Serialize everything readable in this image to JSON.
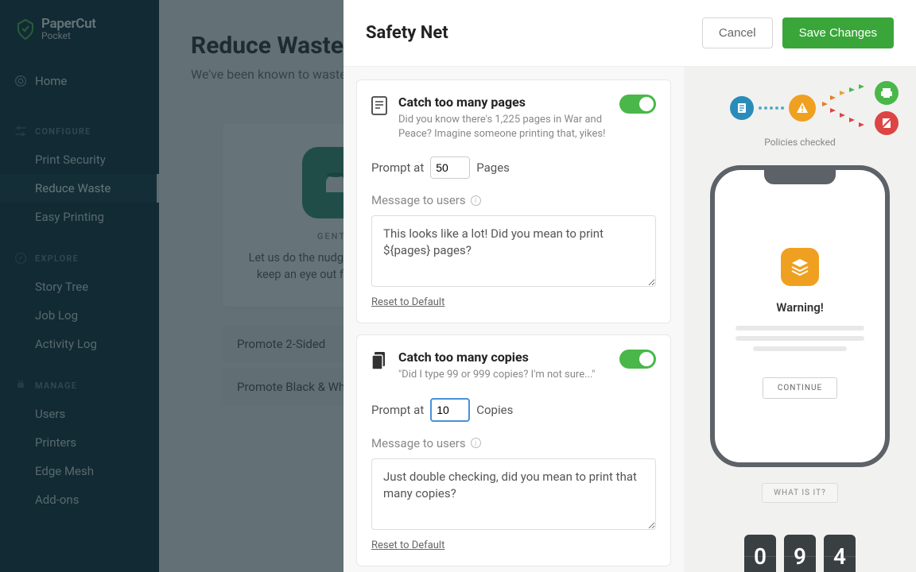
{
  "brand": {
    "title": "PaperCut",
    "subtitle": "Pocket"
  },
  "nav": {
    "home": "Home",
    "configure_header": "CONFIGURE",
    "configure": [
      "Print Security",
      "Reduce Waste",
      "Easy Printing"
    ],
    "explore_header": "EXPLORE",
    "explore": [
      "Story Tree",
      "Job Log",
      "Activity Log"
    ],
    "manage_header": "MANAGE",
    "manage": [
      "Users",
      "Printers",
      "Edge Mesh",
      "Add-ons"
    ]
  },
  "page": {
    "title": "Reduce Waste",
    "subtitle": "We've been known to waste a bit of paper in our time.",
    "card": {
      "badge": "GENTLE",
      "text": "Let us do the nudging for you. We'll keep an eye out for the obvious."
    },
    "promote": [
      "Promote 2-Sided",
      "Promote Black & White"
    ]
  },
  "modal": {
    "title": "Safety Net",
    "cancel": "Cancel",
    "save": "Save Changes",
    "settings": [
      {
        "title": "Catch too many pages",
        "desc": "Did you know there's 1,225 pages in War and Peace? Imagine someone printing that, yikes!",
        "prompt_label_before": "Prompt at",
        "prompt_value": "50",
        "prompt_label_after": "Pages",
        "msg_label": "Message to users",
        "msg": "This looks like a lot! Did you mean to print ${pages} pages?",
        "reset": "Reset to Default",
        "enabled": true
      },
      {
        "title": "Catch too many copies",
        "desc": "\"Did I type 99 or 999 copies? I'm not sure...\"",
        "prompt_label_before": "Prompt at",
        "prompt_value": "10",
        "prompt_label_after": "Copies",
        "msg_label": "Message to users",
        "msg": "Just double checking, did you mean to print that many copies?",
        "reset": "Reset to Default",
        "enabled": true,
        "focused": true
      }
    ],
    "preview": {
      "policies_label": "Policies checked",
      "warning": "Warning!",
      "continue": "CONTINUE",
      "what_is": "WHAT IS IT?",
      "counter": [
        "0",
        "9",
        "4"
      ]
    }
  }
}
